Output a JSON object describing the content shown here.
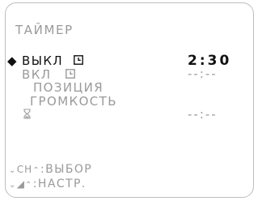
{
  "title": "ТАЙМЕР",
  "menu": {
    "off": {
      "marker": "◆",
      "label": "ВЫКЛ",
      "value": "2:30",
      "icon": "clock-icon"
    },
    "on": {
      "label": "ВКЛ",
      "value": "--:--",
      "icon": "clock-icon"
    },
    "position": {
      "label": "ПОЗИЦИЯ"
    },
    "volume": {
      "label": "ГРОМКОСТЬ"
    },
    "sleep": {
      "icon": "hourglass-icon",
      "value": "--:--"
    }
  },
  "hints": [
    {
      "key": "CH",
      "label": "ВЫБОР",
      "icon": "channel-updown-icon"
    },
    {
      "key": "◢",
      "label": "НАСТР.",
      "icon": "volume-updown-icon"
    }
  ]
}
